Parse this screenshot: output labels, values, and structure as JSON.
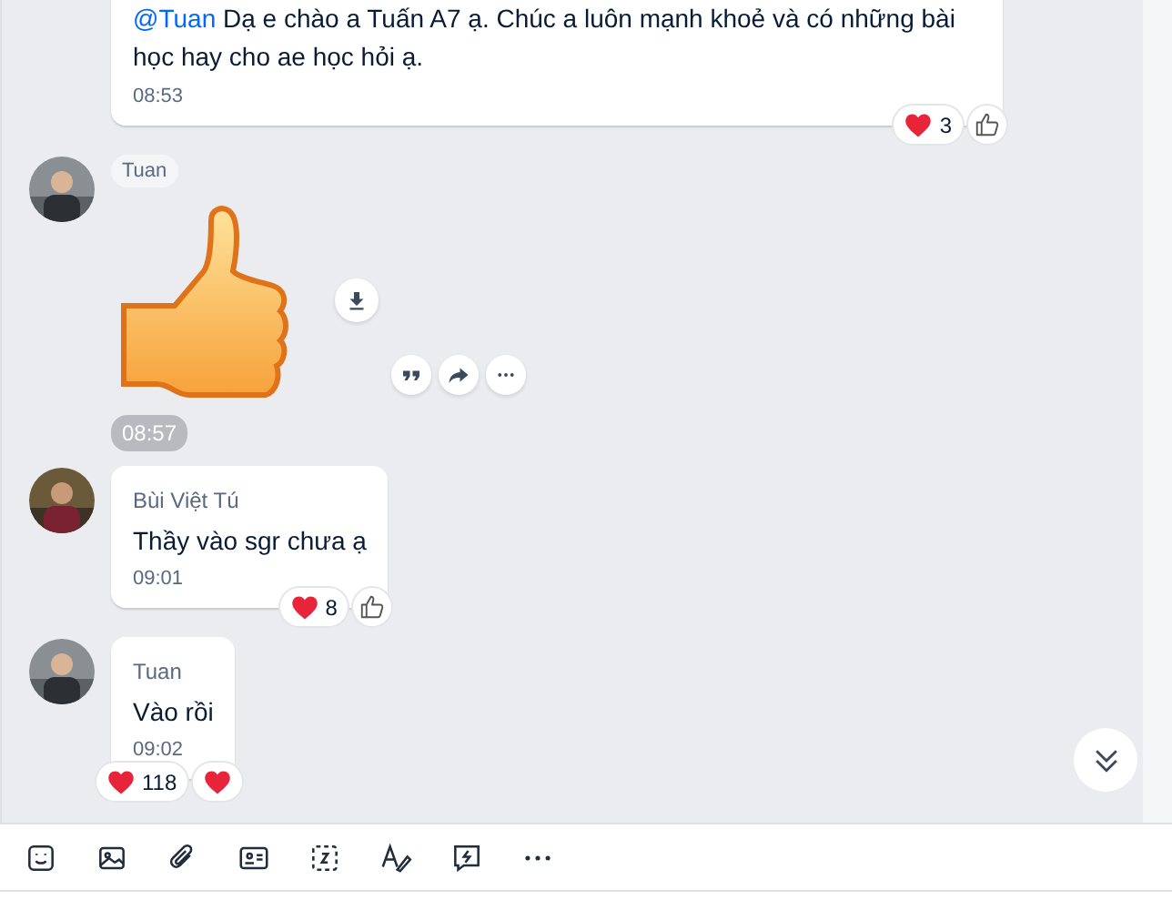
{
  "messages": [
    {
      "kind": "text",
      "mention": "@Tuan",
      "text": "Dạ e chào a Tuấn A7 ạ. Chúc a luôn mạnh khoẻ và có những bài học hay cho ae học hỏi ạ.",
      "time": "08:53",
      "reactions": [
        {
          "kind": "heart",
          "count": "3"
        },
        {
          "kind": "like"
        }
      ]
    },
    {
      "kind": "sticker",
      "avatar": true,
      "sender": "Tuan",
      "time": "08:57"
    },
    {
      "kind": "text",
      "avatar": true,
      "sender": "Bùi Việt Tú",
      "text": "Thầy vào sgr chưa ạ",
      "time": "09:01",
      "reactions": [
        {
          "kind": "heart",
          "count": "8"
        },
        {
          "kind": "like"
        }
      ]
    },
    {
      "kind": "text",
      "avatar": true,
      "sender": "Tuan",
      "text": "Vào rồi",
      "time": "09:02",
      "reactions": [
        {
          "kind": "heart",
          "count": "118"
        },
        {
          "kind": "heart"
        }
      ]
    }
  ]
}
